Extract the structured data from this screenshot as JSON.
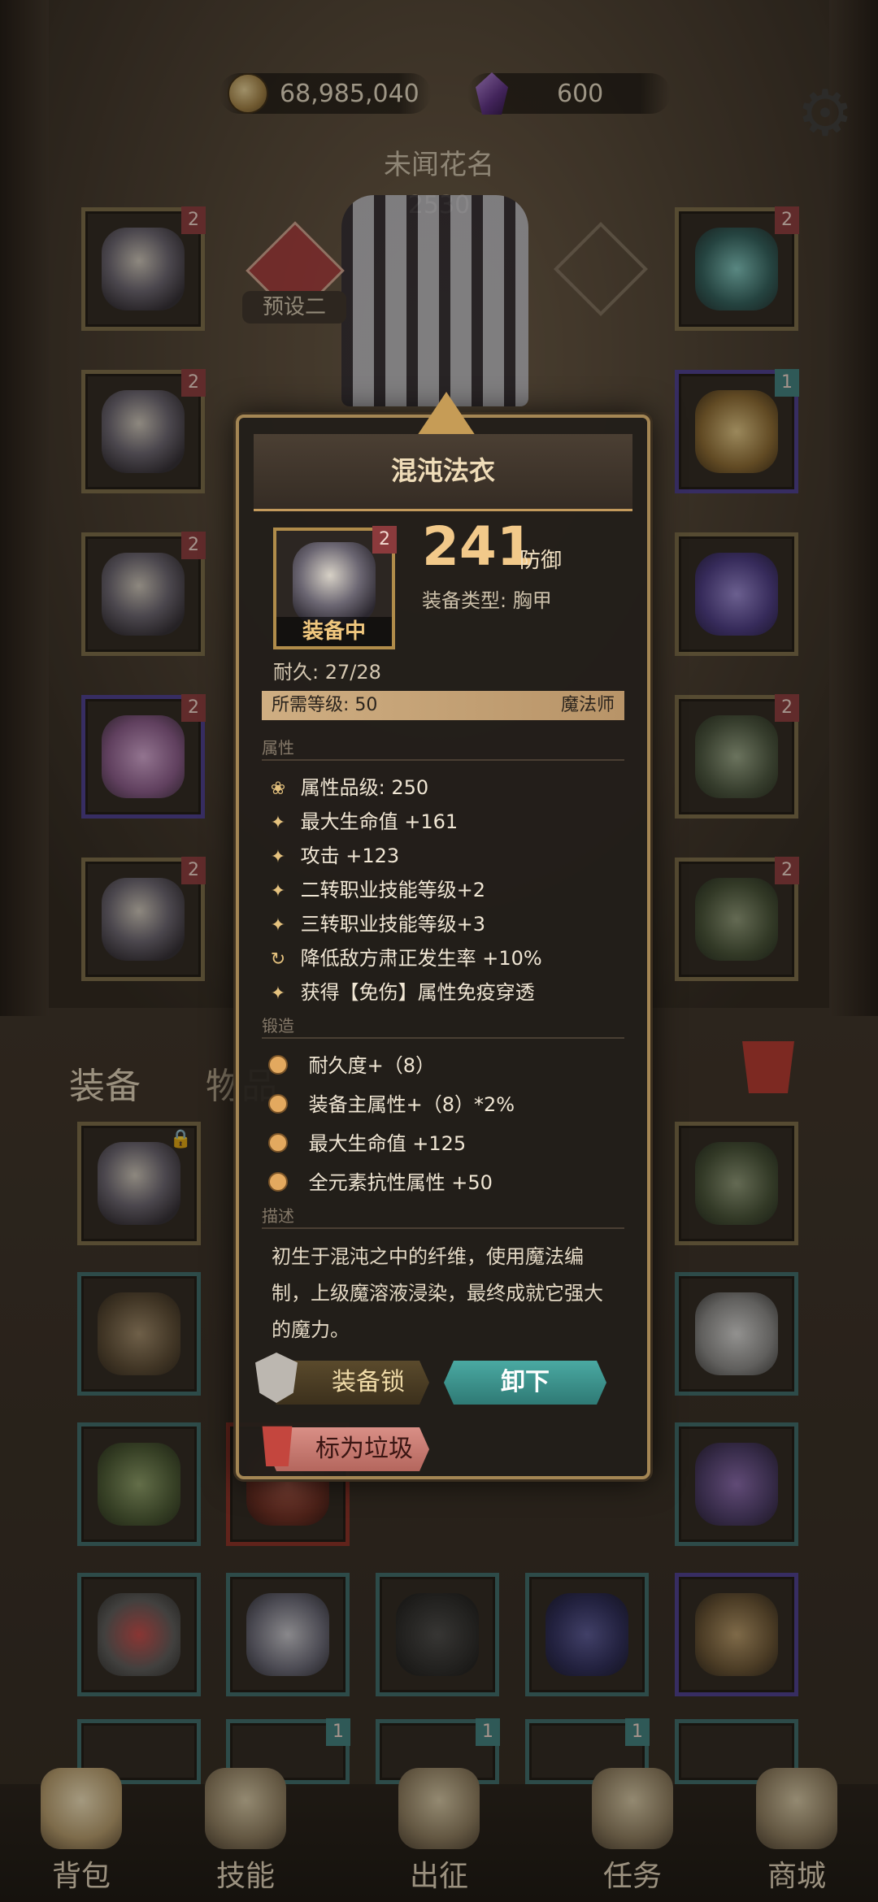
{
  "header": {
    "gold": "68,985,040",
    "gems": "600",
    "character_name": "未闻花名",
    "power": "2530",
    "preset_label": "预设二"
  },
  "left_slots": [
    {
      "badge": "2"
    },
    {
      "badge": "2"
    },
    {
      "badge": "2"
    },
    {
      "badge": "2"
    },
    {
      "badge": "2"
    }
  ],
  "right_slots": [
    {
      "badge": "2"
    },
    {
      "badge": "1"
    },
    {
      "badge": ""
    },
    {
      "badge": "2"
    },
    {
      "badge": "2"
    }
  ],
  "tabs": {
    "equip": "装备",
    "items": "物品"
  },
  "inventory_badges": [
    "1",
    "1",
    "1"
  ],
  "popup": {
    "title": "混沌法衣",
    "badge": "2",
    "equipped_tag": "装备中",
    "defense_value": "241",
    "defense_label": "防御",
    "type_text": "装备类型: 胸甲",
    "durability_text": "耐久: 27/28",
    "required_level_text": "所需等级: 50",
    "required_class": "魔法师",
    "attributes_header": "属性",
    "attributes": [
      "属性品级: 250",
      "最大生命值 +161",
      "攻击 +123",
      "二转职业技能等级+2",
      "三转职业技能等级+3",
      "降低敌方肃正发生率 +10%",
      "获得【免伤】属性免疫穿透"
    ],
    "forge_header": "锻造",
    "forge": [
      "耐久度+（8）",
      "装备主属性+（8）*2%",
      "最大生命值 +125",
      "全元素抗性属性 +50"
    ],
    "description_header": "描述",
    "description": "初生于混沌之中的纤维，使用魔法编制，上级魔溶液浸染，最终成就它强大的魔力。",
    "lock_button": "装备锁",
    "unequip_button": "卸下",
    "junk_button": "标为垃圾"
  },
  "nav": [
    {
      "label": "背包"
    },
    {
      "label": "技能"
    },
    {
      "label": "出征"
    },
    {
      "label": "任务"
    },
    {
      "label": "商城"
    }
  ]
}
